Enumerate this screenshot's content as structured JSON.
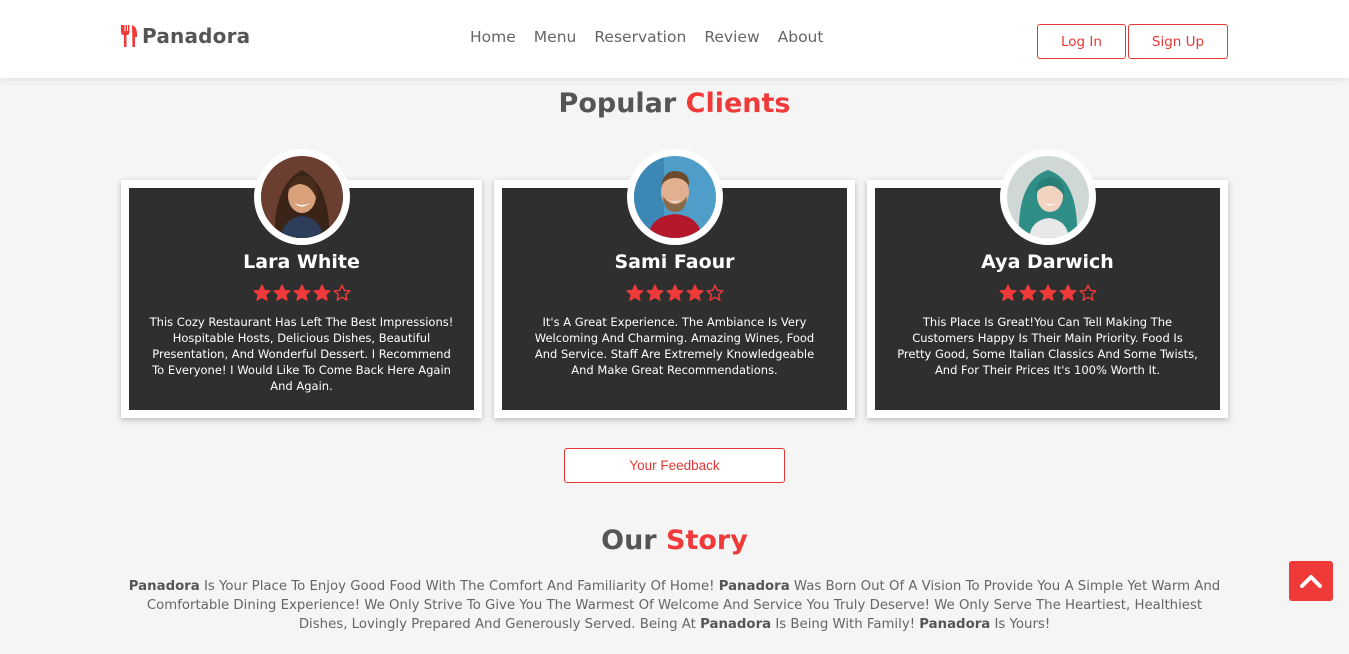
{
  "brand": {
    "name": "Panadora",
    "icon": "utensils-icon",
    "accent": "#f03a3a"
  },
  "nav": {
    "items": [
      "Home",
      "Menu",
      "Reservation",
      "Review",
      "About"
    ]
  },
  "auth": {
    "login": "Log In",
    "signup": "Sign Up"
  },
  "clients_section": {
    "title_main": "Popular",
    "title_accent": "Clients"
  },
  "clients": [
    {
      "name": "Lara White",
      "rating": 4,
      "max_rating": 5,
      "review": "This Cozy Restaurant Has Left The Best Impressions! Hospitable Hosts, Delicious Dishes, Beautiful Presentation, And Wonderful Dessert. I Recommend To Everyone! I Would Like To Come Back Here Again And Again."
    },
    {
      "name": "Sami Faour",
      "rating": 4,
      "max_rating": 5,
      "review": "It's A Great Experience. The Ambiance Is Very Welcoming And Charming. Amazing Wines, Food And Service. Staff Are Extremely Knowledgeable And Make Great Recommendations."
    },
    {
      "name": "Aya Darwich",
      "rating": 4,
      "max_rating": 5,
      "review": "This Place Is Great!You Can Tell Making The Customers Happy Is Their Main Priority. Food Is Pretty Good, Some Italian Classics And Some Twists, And For Their Prices It's 100% Worth It."
    }
  ],
  "feedback_button": "Your Feedback",
  "story_section": {
    "title_main": "Our",
    "title_accent": "Story",
    "segments": [
      {
        "bold": true,
        "text": "Panadora"
      },
      {
        "bold": false,
        "text": " Is Your Place To Enjoy Good Food With The Comfort And Familiarity Of Home! "
      },
      {
        "bold": true,
        "text": "Panadora"
      },
      {
        "bold": false,
        "text": " Was Born Out Of A Vision To Provide You A Simple Yet Warm And Comfortable Dining Experience! We Only Strive To Give You The Warmest Of Welcome And Service You Truly Deserve! We Only Serve The Heartiest, Healthiest Dishes, Lovingly Prepared And Generously Served. Being At "
      },
      {
        "bold": true,
        "text": "Panadora"
      },
      {
        "bold": false,
        "text": " Is Being With Family! "
      },
      {
        "bold": true,
        "text": "Panadora"
      },
      {
        "bold": false,
        "text": " Is Yours!"
      }
    ]
  },
  "scroll_top": {
    "icon": "chevron-up-icon"
  }
}
